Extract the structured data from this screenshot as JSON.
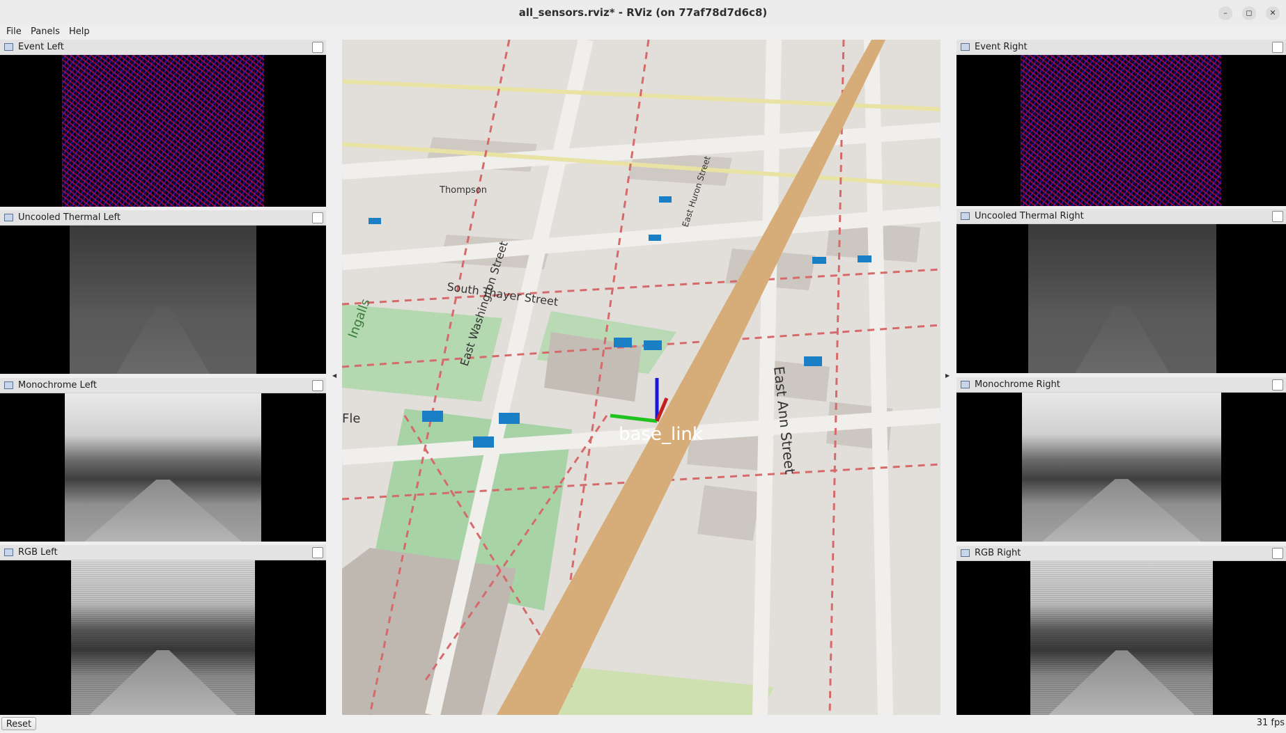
{
  "window": {
    "title": "all_sensors.rviz* - RViz (on 77af78d7d6c8)",
    "minimize_glyph": "–",
    "restore_glyph": "◻",
    "close_glyph": "✕"
  },
  "menubar": {
    "file": "File",
    "panels": "Panels",
    "help": "Help"
  },
  "left_panels": [
    {
      "label": "Event Left"
    },
    {
      "label": "Uncooled Thermal Left"
    },
    {
      "label": "Monochrome Left"
    },
    {
      "label": "RGB Left"
    }
  ],
  "right_panels": [
    {
      "label": "Event Right"
    },
    {
      "label": "Uncooled Thermal Right"
    },
    {
      "label": "Monochrome Right"
    },
    {
      "label": "RGB Right"
    }
  ],
  "viewport": {
    "frame_label": "base_link",
    "streets": [
      "South Thayer Street",
      "East Washington Street",
      "East Ann Street",
      "East Huron Street",
      "Thompson",
      "Ingalls",
      "Fle"
    ],
    "axis_colors": {
      "x": "#c2201a",
      "y": "#1fc21f",
      "z": "#1a1ad6"
    }
  },
  "splitter": {
    "left_arrow": "◀",
    "right_arrow": "▶"
  },
  "statusbar": {
    "reset": "Reset",
    "fps": "31 fps"
  },
  "icons": [
    "panel-image-icon",
    "minimize-icon",
    "restore-icon",
    "close-icon"
  ]
}
